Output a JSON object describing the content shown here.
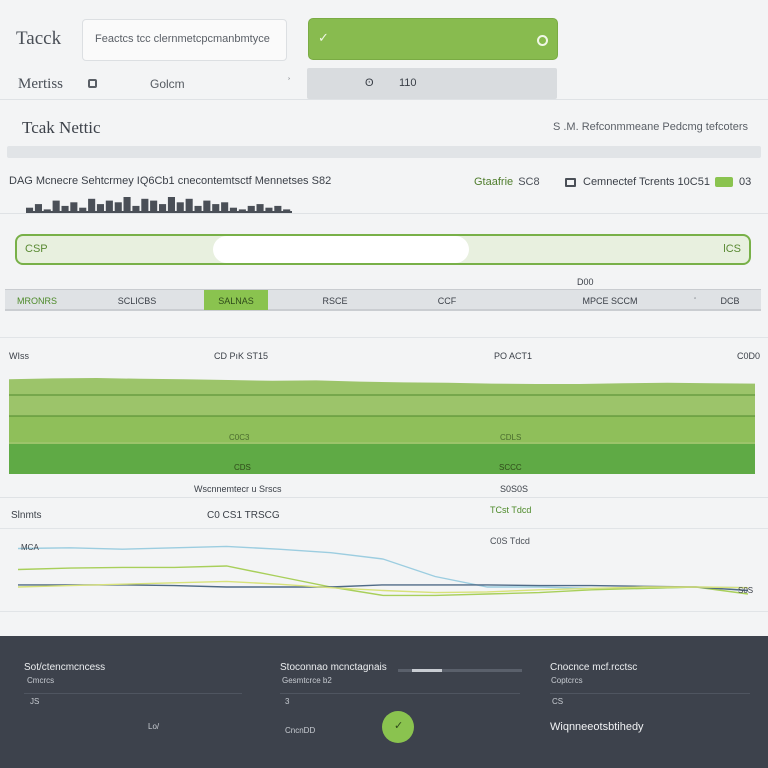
{
  "header": {
    "app_title": "Tacck",
    "search_text": "Feactcs tcc clernmetcpcmanbmtyce",
    "metrics_label": "Mertiss",
    "column_label": "Golcm",
    "column_caret": "ʾ",
    "filter_a": "ʘ",
    "filter_b": "110"
  },
  "section": {
    "title": "Tcak Nettic",
    "subtitle": "S .M.  Refconmmeane Pedcmg tefcoters",
    "stat_label": "DAG Mcnecre Sehtcrmey IQ6Cb1 cnecontemtsctf Mennetses S82",
    "stat_group_a": "Gtaafrie",
    "stat_group_b": "SC8",
    "stat_right": "Cemnectef Tcrents 10C51",
    "stat_count": "03",
    "sparkline": [
      3,
      5,
      2,
      7,
      4,
      6,
      3,
      8,
      5,
      7,
      6,
      9,
      4,
      8,
      7,
      5,
      9,
      6,
      8,
      4,
      7,
      5,
      6,
      3,
      2,
      4,
      5,
      3,
      4,
      2
    ],
    "input_label": "CSP",
    "input_end": "lCS",
    "tiny_top": "D00"
  },
  "tabs": [
    {
      "label": "MRONRS"
    },
    {
      "label": "SCLICBS"
    },
    {
      "label": "SALNAS"
    },
    {
      "label": "RSCE"
    },
    {
      "label": "CCF"
    },
    {
      "label": "MPCE SCCM"
    },
    {
      "label": "ʾ"
    },
    {
      "label": "DCB"
    }
  ],
  "rows": {
    "row1_left": "WIss",
    "row1_mid": "CD PıK ST15",
    "row1_right": "PO ACT1",
    "row1_far": "C0D0",
    "mid_val_1": "C0C3",
    "mid_val_2": "CDLS",
    "mid_val_3": "CDS",
    "mid_val_4": "SCCC",
    "below_left": "Wscnnemtecr u Srscs",
    "below_right": "S0S0S",
    "row2_left": "Slnmts",
    "row2_mid": "C0 CS1 TRSCG",
    "green_note_1": "TCst  Tdcd",
    "green_note_2": "C0S  Tdcd",
    "lc_label": "MCA",
    "lc_end": "S0S"
  },
  "area_chart": {
    "top_band": [
      0.72,
      0.74,
      0.75,
      0.73,
      0.72,
      0.7,
      0.68,
      0.69,
      0.66,
      0.64,
      0.63,
      0.61,
      0.6,
      0.6,
      0.62,
      0.63,
      0.62,
      0.61
    ],
    "colors": {
      "light": "#9cc46a",
      "mid": "#8fbf5a",
      "dark": "#5faa45",
      "line": "#4f8a2d"
    }
  },
  "line_chart": {
    "series": [
      {
        "color": "#9ccde0",
        "values": [
          0.85,
          0.86,
          0.84,
          0.86,
          0.88,
          0.84,
          0.79,
          0.7,
          0.45,
          0.3,
          0.3,
          0.28,
          0.28,
          0.3,
          0.29
        ]
      },
      {
        "color": "#a8cf5a",
        "values": [
          0.55,
          0.57,
          0.58,
          0.58,
          0.6,
          0.45,
          0.3,
          0.18,
          0.18,
          0.2,
          0.22,
          0.26,
          0.28,
          0.3,
          0.2
        ]
      },
      {
        "color": "#4f6a86",
        "values": [
          0.33,
          0.33,
          0.33,
          0.32,
          0.3,
          0.3,
          0.3,
          0.33,
          0.33,
          0.33,
          0.32,
          0.32,
          0.31,
          0.3,
          0.25
        ]
      },
      {
        "color": "#d8e27a",
        "values": [
          0.3,
          0.32,
          0.34,
          0.36,
          0.38,
          0.34,
          0.29,
          0.25,
          0.22,
          0.23,
          0.26,
          0.28,
          0.3,
          0.3,
          0.29
        ]
      }
    ]
  },
  "footer": {
    "col1_title": "Sot/ctencmcncess",
    "col1_sub": "Cmcrcs",
    "col1_small_a": "JS",
    "col1_small_b": "Lo/",
    "col2_title": "Stoconnao mcnctagnais",
    "col2_sub": "Gesmtcrce b2",
    "col2_small_a": "3",
    "col2_small_b": "CncnDD",
    "col3_title": "Cnocnce mcf.rcctsc",
    "col3_sub": "Coptcrcs",
    "col3_small": "CS",
    "col3_strong": "Wiqnneeotsbtihedy",
    "btn_icon": "✓"
  }
}
